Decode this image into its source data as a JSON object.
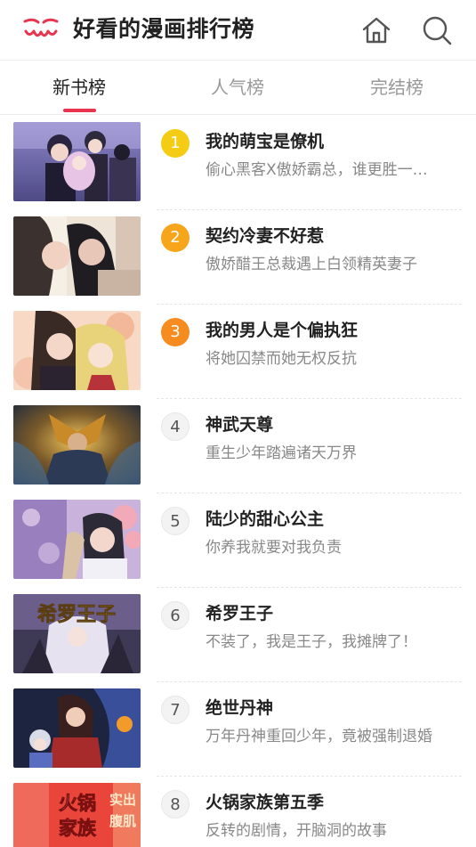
{
  "header": {
    "title": "好看的漫画排行榜",
    "brand_color": "#e8344e",
    "icons": [
      "logo-icon",
      "home-icon",
      "search-icon"
    ]
  },
  "tabs": [
    {
      "label": "新书榜",
      "active": true
    },
    {
      "label": "人气榜",
      "active": false
    },
    {
      "label": "完结榜",
      "active": false
    }
  ],
  "rankings": [
    {
      "rank": "1",
      "title": "我的萌宝是僚机",
      "desc": "偷心黑客X傲娇霸总，谁更胜一…"
    },
    {
      "rank": "2",
      "title": "契约冷妻不好惹",
      "desc": "傲娇醋王总裁遇上白领精英妻子"
    },
    {
      "rank": "3",
      "title": "我的男人是个偏执狂",
      "desc": "将她囚禁而她无权反抗"
    },
    {
      "rank": "4",
      "title": "神武天尊",
      "desc": "重生少年踏遍诸天万界"
    },
    {
      "rank": "5",
      "title": "陆少的甜心公主",
      "desc": "你养我就要对我负责"
    },
    {
      "rank": "6",
      "title": "希罗王子",
      "desc": "不装了，我是王子，我摊牌了！"
    },
    {
      "rank": "7",
      "title": "绝世丹神",
      "desc": "万年丹神重回少年，竟被强制退婚"
    },
    {
      "rank": "8",
      "title": "火锅家族第五季",
      "desc": "反转的剧情，开脑洞的故事"
    }
  ],
  "cover_texts": {
    "cover6": "希罗王子",
    "cover8_big": [
      "火锅",
      "家族"
    ],
    "cover8_side": [
      "实出",
      "腹肌"
    ]
  },
  "rank_colors": {
    "gold": "#f5cc14",
    "orange1": "#f7a51b",
    "orange2": "#f68b1f"
  }
}
